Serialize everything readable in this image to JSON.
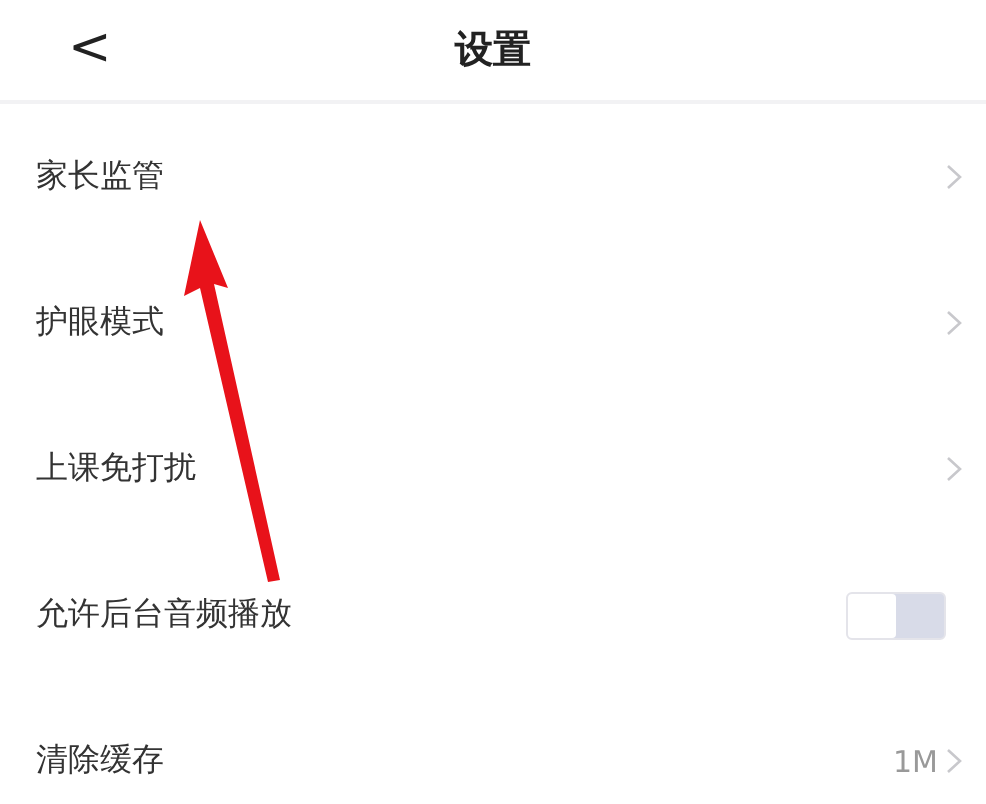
{
  "header": {
    "back": "<",
    "title": "设置"
  },
  "rows": [
    {
      "kind": "link",
      "label": "家长监管"
    },
    {
      "kind": "link",
      "label": "护眼模式"
    },
    {
      "kind": "link",
      "label": "上课免打扰"
    },
    {
      "kind": "toggle",
      "label": "允许后台音频播放",
      "on": false
    },
    {
      "kind": "value",
      "label": "清除缓存",
      "value": "1M"
    }
  ]
}
